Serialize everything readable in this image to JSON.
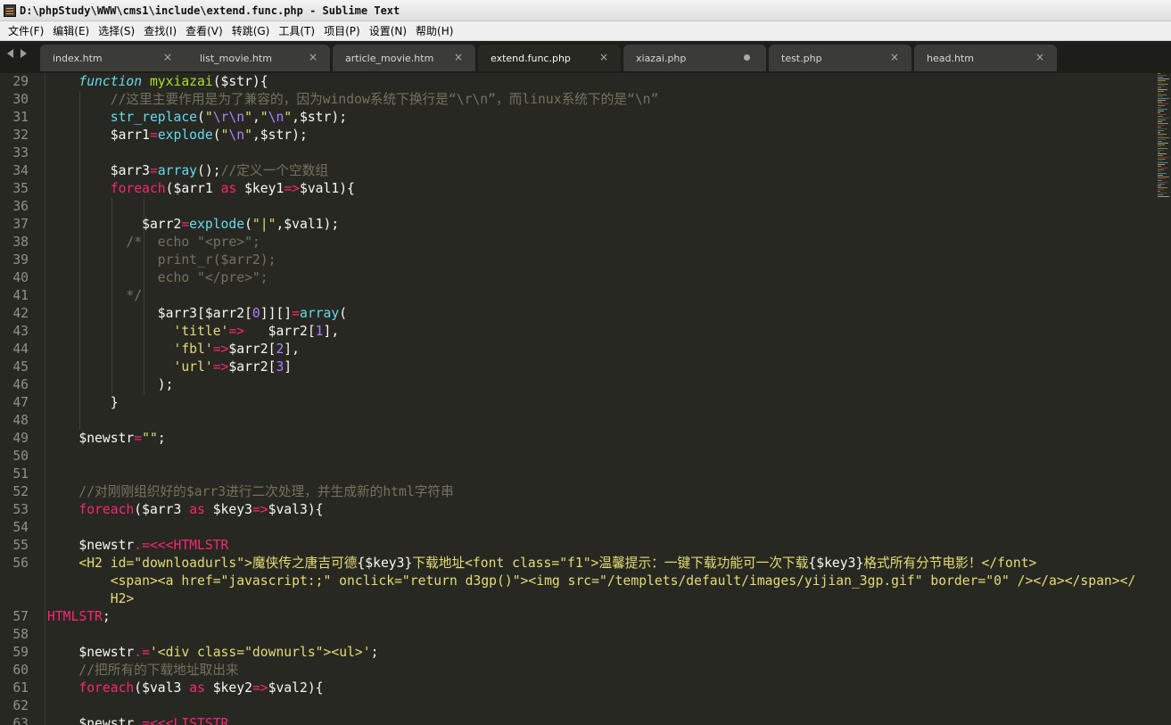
{
  "window": {
    "title": "D:\\phpStudy\\WWW\\cms1\\include\\extend.func.php - Sublime Text"
  },
  "menu": [
    {
      "label": "文件(F)"
    },
    {
      "label": "编辑(E)"
    },
    {
      "label": "选择(S)"
    },
    {
      "label": "查找(I)"
    },
    {
      "label": "查看(V)"
    },
    {
      "label": "转跳(G)"
    },
    {
      "label": "工具(T)"
    },
    {
      "label": "项目(P)"
    },
    {
      "label": "设置(N)"
    },
    {
      "label": "帮助(H)"
    }
  ],
  "tabs": [
    {
      "label": "index.htm",
      "active": false,
      "modified": false
    },
    {
      "label": "list_movie.htm",
      "active": false,
      "modified": false
    },
    {
      "label": "article_movie.htm",
      "active": false,
      "modified": false
    },
    {
      "label": "extend.func.php",
      "active": true,
      "modified": false
    },
    {
      "label": "xiazai.php",
      "active": false,
      "modified": true
    },
    {
      "label": "test.php",
      "active": false,
      "modified": false
    },
    {
      "label": "head.htm",
      "active": false,
      "modified": false
    }
  ],
  "tab_close_glyph": "×",
  "colors": {
    "background": "#272822",
    "keyword": "#66d9ef",
    "function": "#a6e22e",
    "operator": "#f92672",
    "string": "#e6db74",
    "number": "#ae81ff",
    "comment": "#75715e",
    "text": "#f8f8f2"
  },
  "icons": {
    "app": "sublime-text-icon",
    "nav_left": "tab-scroll-left-icon",
    "nav_right": "tab-scroll-right-icon",
    "close": "close-icon",
    "modified": "unsaved-dot-icon"
  },
  "code_lines": [
    {
      "n": "29",
      "t": [
        [
          "    ",
          "tx"
        ],
        [
          "function",
          "kw"
        ],
        [
          " ",
          "tx"
        ],
        [
          "myxiazai",
          "fn"
        ],
        [
          "($str){",
          "tx"
        ]
      ]
    },
    {
      "n": "30",
      "t": [
        [
          "        //这里主要作用是为了兼容的，因为window系统下换行是“\\r\\n”，而linux系统下的是“\\n”",
          "cm"
        ]
      ]
    },
    {
      "n": "31",
      "t": [
        [
          "        ",
          "tx"
        ],
        [
          "str_replace",
          "bi"
        ],
        [
          "(",
          "tx"
        ],
        [
          "\"",
          "str"
        ],
        [
          "\\r\\n",
          "num"
        ],
        [
          "\"",
          "str"
        ],
        [
          ",",
          "tx"
        ],
        [
          "\"",
          "str"
        ],
        [
          "\\n",
          "num"
        ],
        [
          "\"",
          "str"
        ],
        [
          ",$str);",
          "tx"
        ]
      ]
    },
    {
      "n": "32",
      "t": [
        [
          "        $arr1",
          "tx"
        ],
        [
          "=",
          "op"
        ],
        [
          "explode",
          "bi"
        ],
        [
          "(",
          "tx"
        ],
        [
          "\"",
          "str"
        ],
        [
          "\\n",
          "num"
        ],
        [
          "\"",
          "str"
        ],
        [
          ",$str);",
          "tx"
        ]
      ]
    },
    {
      "n": "33",
      "t": []
    },
    {
      "n": "34",
      "t": [
        [
          "        $arr3",
          "tx"
        ],
        [
          "=",
          "op"
        ],
        [
          "array",
          "bi"
        ],
        [
          "();",
          "tx"
        ],
        [
          "//定义一个空数组",
          "cm"
        ]
      ]
    },
    {
      "n": "35",
      "t": [
        [
          "        ",
          "tx"
        ],
        [
          "foreach",
          "op"
        ],
        [
          "($arr1 ",
          "tx"
        ],
        [
          "as",
          "op"
        ],
        [
          " $key1",
          "tx"
        ],
        [
          "=>",
          "op"
        ],
        [
          "$val1){",
          "tx"
        ]
      ]
    },
    {
      "n": "36",
      "t": []
    },
    {
      "n": "37",
      "t": [
        [
          "            $arr2",
          "tx"
        ],
        [
          "=",
          "op"
        ],
        [
          "explode",
          "bi"
        ],
        [
          "(",
          "tx"
        ],
        [
          "\"|\"",
          "str"
        ],
        [
          ",$val1);",
          "tx"
        ]
      ]
    },
    {
      "n": "38",
      "t": [
        [
          "          /*  echo \"<pre>\";",
          "cm"
        ]
      ]
    },
    {
      "n": "39",
      "t": [
        [
          "              print_r($arr2);",
          "cm"
        ]
      ]
    },
    {
      "n": "40",
      "t": [
        [
          "              echo \"</pre>\";",
          "cm"
        ]
      ]
    },
    {
      "n": "41",
      "t": [
        [
          "          */",
          "cm"
        ]
      ]
    },
    {
      "n": "42",
      "t": [
        [
          "              $arr3[$arr2[",
          "tx"
        ],
        [
          "0",
          "num"
        ],
        [
          "]][]",
          "tx"
        ],
        [
          "=",
          "op"
        ],
        [
          "array",
          "bi"
        ],
        [
          "(",
          "tx"
        ]
      ]
    },
    {
      "n": "43",
      "t": [
        [
          "                ",
          "tx"
        ],
        [
          "'title'",
          "str"
        ],
        [
          "=>",
          "op"
        ],
        [
          "   $arr2[",
          "tx"
        ],
        [
          "1",
          "num"
        ],
        [
          "],",
          "tx"
        ]
      ]
    },
    {
      "n": "44",
      "t": [
        [
          "                ",
          "tx"
        ],
        [
          "'fbl'",
          "str"
        ],
        [
          "=>",
          "op"
        ],
        [
          "$arr2[",
          "tx"
        ],
        [
          "2",
          "num"
        ],
        [
          "],",
          "tx"
        ]
      ]
    },
    {
      "n": "45",
      "t": [
        [
          "                ",
          "tx"
        ],
        [
          "'url'",
          "str"
        ],
        [
          "=>",
          "op"
        ],
        [
          "$arr2[",
          "tx"
        ],
        [
          "3",
          "num"
        ],
        [
          "]",
          "tx"
        ]
      ]
    },
    {
      "n": "46",
      "t": [
        [
          "              );",
          "tx"
        ]
      ]
    },
    {
      "n": "47",
      "t": [
        [
          "        }",
          "tx"
        ]
      ]
    },
    {
      "n": "48",
      "t": []
    },
    {
      "n": "49",
      "t": [
        [
          "    $newstr",
          "tx"
        ],
        [
          "=",
          "op"
        ],
        [
          "\"\"",
          "str"
        ],
        [
          ";",
          "tx"
        ]
      ]
    },
    {
      "n": "50",
      "t": []
    },
    {
      "n": "51",
      "t": []
    },
    {
      "n": "52",
      "t": [
        [
          "    //对刚刚组织好的$arr3进行二次处理，并生成新的html字符串",
          "cm"
        ]
      ]
    },
    {
      "n": "53",
      "t": [
        [
          "    ",
          "tx"
        ],
        [
          "foreach",
          "op"
        ],
        [
          "($arr3 ",
          "tx"
        ],
        [
          "as",
          "op"
        ],
        [
          " $key3",
          "tx"
        ],
        [
          "=>",
          "op"
        ],
        [
          "$val3){",
          "tx"
        ]
      ]
    },
    {
      "n": "54",
      "t": []
    },
    {
      "n": "55",
      "t": [
        [
          "    $newstr",
          "tx"
        ],
        [
          ".=",
          "op"
        ],
        [
          "<<<",
          "op"
        ],
        [
          "HTMLSTR",
          "op"
        ]
      ]
    },
    {
      "n": "56",
      "t": [
        [
          "    <H2 id=\"downloadurls\">魔侠传之唐吉可德",
          "str"
        ],
        [
          "{$key3}",
          "tx"
        ],
        [
          "下载地址<font class=\"f1\">温馨提示：一键下载功能可一次下载",
          "str"
        ],
        [
          "{$key3}",
          "tx"
        ],
        [
          "格式所有分节电影！</font>",
          "str"
        ]
      ]
    },
    {
      "n": "",
      "t": [
        [
          "        <span><a href=\"javascript:;\" onclick=\"return d3gp()\"><img src=\"/templets/default/images/yijian_3gp.gif\" border=\"0\" /></a></span></",
          "str"
        ]
      ]
    },
    {
      "n": "",
      "t": [
        [
          "        H2>",
          "str"
        ]
      ]
    },
    {
      "n": "57",
      "t": [
        [
          "HTMLSTR",
          "op"
        ],
        [
          ";",
          "tx"
        ]
      ]
    },
    {
      "n": "58",
      "t": []
    },
    {
      "n": "59",
      "t": [
        [
          "    $newstr",
          "tx"
        ],
        [
          ".=",
          "op"
        ],
        [
          "'<div class=\"downurls\"><ul>'",
          "str"
        ],
        [
          ";",
          "tx"
        ]
      ]
    },
    {
      "n": "60",
      "t": [
        [
          "    //把所有的下载地址取出来",
          "cm"
        ]
      ]
    },
    {
      "n": "61",
      "t": [
        [
          "    ",
          "tx"
        ],
        [
          "foreach",
          "op"
        ],
        [
          "($val3 ",
          "tx"
        ],
        [
          "as",
          "op"
        ],
        [
          " $key2",
          "tx"
        ],
        [
          "=>",
          "op"
        ],
        [
          "$val2){",
          "tx"
        ]
      ]
    },
    {
      "n": "62",
      "t": []
    },
    {
      "n": "63",
      "t": [
        [
          "    $newstr",
          "tx"
        ],
        [
          ".=",
          "op"
        ],
        [
          "<<<",
          "op"
        ],
        [
          "LISTSTR",
          "op"
        ]
      ]
    }
  ]
}
